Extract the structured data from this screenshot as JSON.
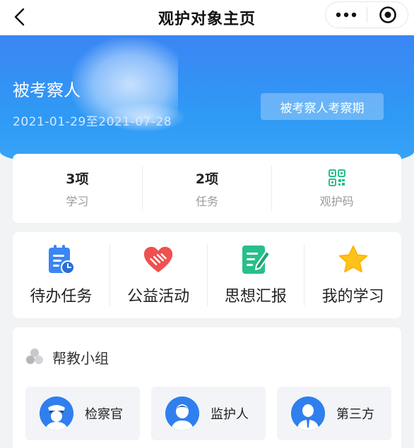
{
  "navbar": {
    "title": "观护对象主页",
    "back_icon": "chevron-left-icon",
    "more_icon": "more-dots-icon",
    "close_icon": "target-close-icon"
  },
  "profile": {
    "name": "被考察人",
    "date_range": "2021-01-29至2021-07-28",
    "period_button": "被考察人考察期"
  },
  "stats": [
    {
      "value": "3项",
      "label": "学习"
    },
    {
      "value": "2项",
      "label": "任务"
    },
    {
      "value": "",
      "label": "观护码",
      "icon": "qr-code-icon"
    }
  ],
  "actions": [
    {
      "label": "待办任务",
      "icon": "todo-clipboard-icon"
    },
    {
      "label": "公益活动",
      "icon": "heart-handshake-icon"
    },
    {
      "label": "思想汇报",
      "icon": "report-edit-icon"
    },
    {
      "label": "我的学习",
      "icon": "star-icon"
    }
  ],
  "help_group": {
    "title": "帮教小组",
    "members": [
      {
        "label": "检察官",
        "icon": "prosecutor-avatar-icon"
      },
      {
        "label": "监护人",
        "icon": "guardian-avatar-icon"
      },
      {
        "label": "第三方",
        "icon": "third-party-avatar-icon"
      }
    ]
  },
  "colors": {
    "primary_blue": "#3b86f4",
    "green": "#27c08a",
    "red": "#f0504f",
    "yellow": "#ffc21a"
  }
}
